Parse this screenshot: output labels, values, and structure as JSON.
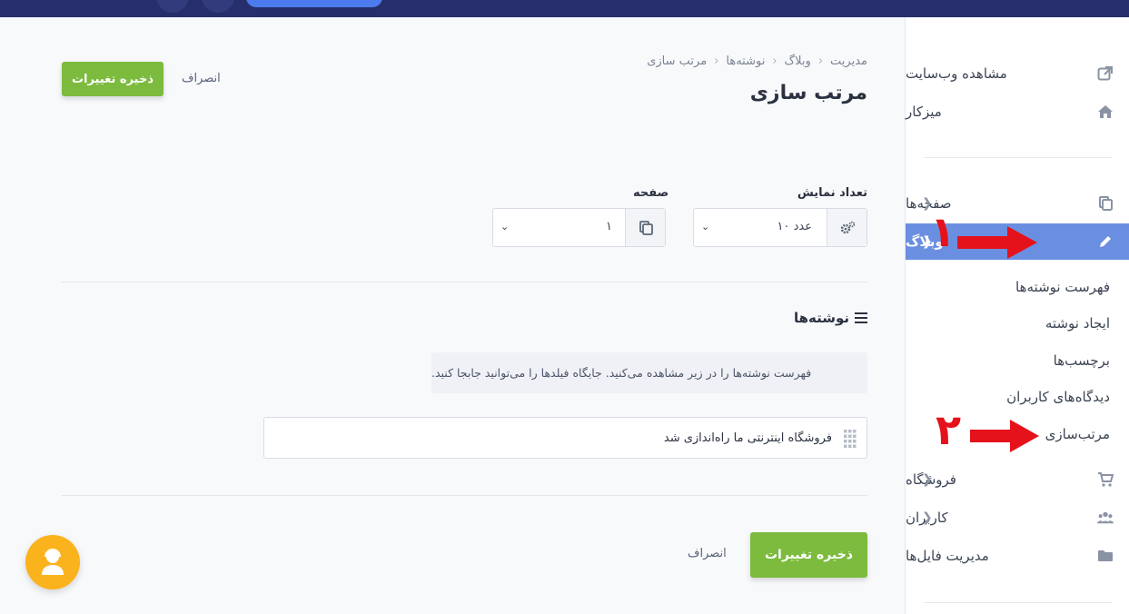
{
  "header": {
    "breadcrumb": [
      "مدیریت",
      "وبلاگ",
      "نوشته‌ها",
      "مرتب سازی"
    ],
    "title": "مرتب سازی",
    "save_label": "ذخیره تغییرات",
    "cancel_label": "انصراف"
  },
  "sidebar": {
    "items": [
      {
        "label": "مشاهده وب‌سایت",
        "icon": "external-link-icon"
      },
      {
        "label": "میزکار",
        "icon": "home-icon"
      },
      {
        "label": "صفحه‌ها",
        "icon": "copy-icon"
      },
      {
        "label": "وبلاگ",
        "icon": "pencil-icon"
      },
      {
        "label": "فروشگاه",
        "icon": "cart-icon"
      },
      {
        "label": "کاربران",
        "icon": "users-icon"
      },
      {
        "label": "مدیریت فایل‌ها",
        "icon": "folder-icon"
      }
    ],
    "blog_submenu": [
      "فهرست نوشته‌ها",
      "ایجاد نوشته",
      "برچسب‌ها",
      "دیدگاه‌های کاربران",
      "مرتب‌سازی"
    ]
  },
  "filters": {
    "display_count_label": "تعداد نمایش",
    "display_count_value": "۱۰ عدد",
    "page_label": "صفحه",
    "page_value": "۱"
  },
  "posts_section": {
    "title": "نوشته‌ها",
    "info": "فهرست نوشته‌ها را در زیر مشاهده می‌کنید. جایگاه فیلدها را می‌توانید جابجا کنید.",
    "items": [
      "فروشگاه اینترنتی ما راه‌اندازی شد"
    ]
  },
  "footer": {
    "save_label": "ذخیره تغییرات",
    "cancel_label": "انصراف"
  },
  "annotations": {
    "num1": "۱",
    "num2": "۲",
    "color": "#e5121b"
  },
  "colors": {
    "topbar": "#262f6b",
    "active_menu": "#6b8fe0",
    "save_button": "#7cbb3e",
    "support_button": "#fbb31d"
  }
}
